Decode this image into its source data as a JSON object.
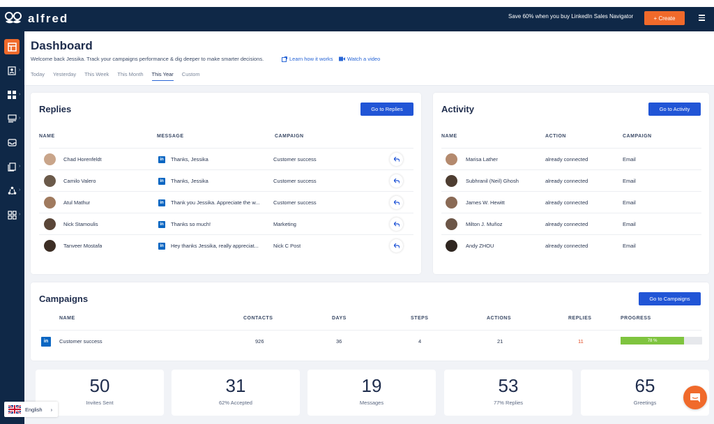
{
  "app": {
    "logo_text": "alfred"
  },
  "topbar": {
    "promo": "Save 60% when you buy LinkedIn Sales Navigator",
    "create_label": "+ Create"
  },
  "sidebar": {
    "items": [
      "dashboard-icon",
      "contacts-icon",
      "campaigns-icon",
      "templates-icon",
      "inbox-icon",
      "documents-icon",
      "integrations-icon",
      "apps-icon"
    ]
  },
  "header": {
    "title": "Dashboard",
    "welcome": "Welcome back Jessika. Track your campaigns performance & dig deeper to make smarter decisions.",
    "learn_link": "Learn how it works",
    "video_link": "Watch a video",
    "tabs": [
      "Today",
      "Yesterday",
      "This Week",
      "This Month",
      "This Year",
      "Custom"
    ],
    "active_tab": "This Year"
  },
  "replies": {
    "title": "Replies",
    "button": "Go to Replies",
    "columns": [
      "NAME",
      "MESSAGE",
      "CAMPAIGN"
    ],
    "rows": [
      {
        "name": "Chad Horenfeldt",
        "message": "Thanks, Jessika",
        "campaign": "Customer success"
      },
      {
        "name": "Camilo Valero",
        "message": "Thanks, Jessika",
        "campaign": "Customer success"
      },
      {
        "name": "Atul Mathur",
        "message": "Thank you Jessika. Appreciate the w...",
        "campaign": "Customer success"
      },
      {
        "name": "Nick Stamoulis",
        "message": "Thanks so much!",
        "campaign": "Marketing"
      },
      {
        "name": "Tanveer Mostafa",
        "message": "Hey thanks Jessika, really appreciat...",
        "campaign": "Nick C Post"
      }
    ]
  },
  "activity": {
    "title": "Activity",
    "button": "Go to Activity",
    "columns": [
      "NAME",
      "ACTION",
      "CAMPAIGN"
    ],
    "rows": [
      {
        "name": "Marisa Lather",
        "action": "already connected",
        "campaign": "Email"
      },
      {
        "name": "Subhranil (Neil) Ghosh",
        "action": "already connected",
        "campaign": "Email"
      },
      {
        "name": "James W. Hewitt",
        "action": "already connected",
        "campaign": "Email"
      },
      {
        "name": "Milton J. Muñoz",
        "action": "already connected",
        "campaign": "Email"
      },
      {
        "name": "Andy ZHOU",
        "action": "already connected",
        "campaign": "Email"
      }
    ]
  },
  "campaigns": {
    "title": "Campaigns",
    "button": "Go to Campaigns",
    "columns": [
      "NAME",
      "CONTACTS",
      "DAYS",
      "STEPS",
      "ACTIONS",
      "REPLIES",
      "PROGRESS"
    ],
    "row": {
      "name": "Customer success",
      "contacts": "926",
      "days": "36",
      "steps": "4",
      "actions": "21",
      "replies": "11",
      "progress": 0.78,
      "progress_label": "78 %"
    }
  },
  "stats": [
    {
      "value": "50",
      "label": "Invites Sent"
    },
    {
      "value": "31",
      "label": "62% Accepted"
    },
    {
      "value": "19",
      "label": "Messages"
    },
    {
      "value": "53",
      "label": "77% Replies"
    },
    {
      "value": "65",
      "label": "Greetings"
    }
  ],
  "language": {
    "label": "English"
  },
  "colors": {
    "navy": "#0f2847",
    "orange": "#f06a2b",
    "blue": "#2155d6",
    "green": "#7fc43f"
  }
}
